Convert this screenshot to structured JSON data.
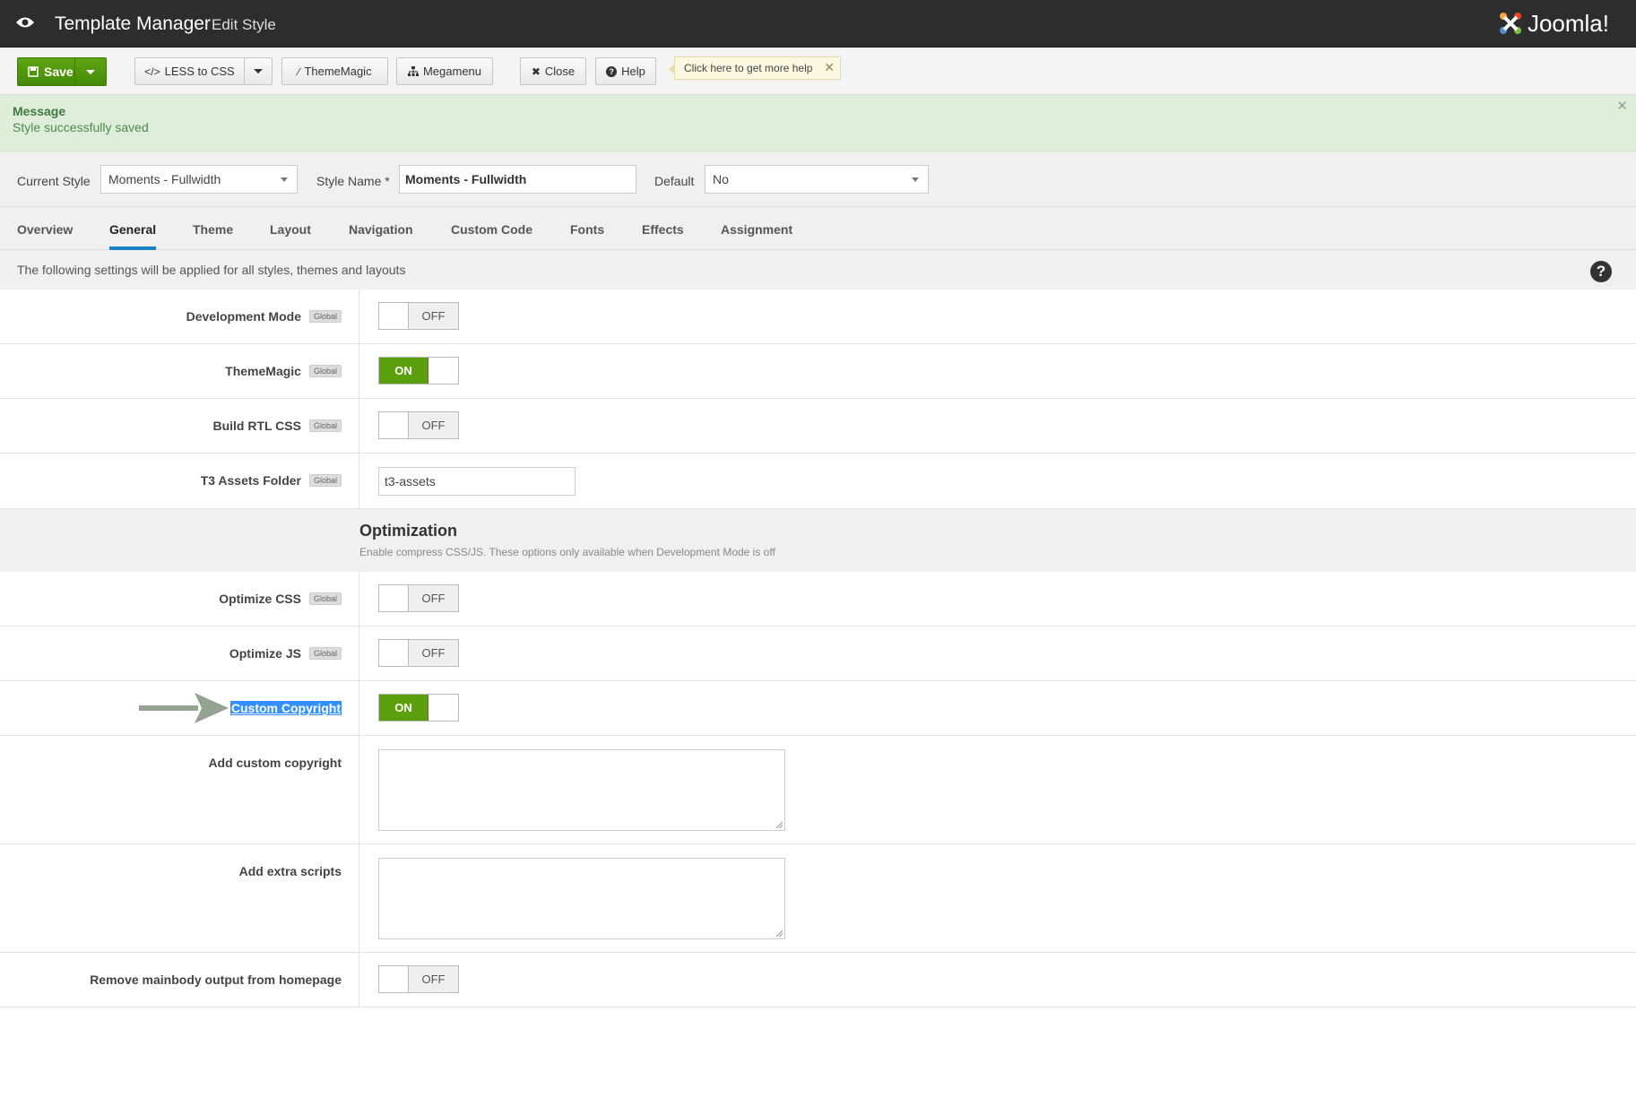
{
  "header": {
    "title": "Template Manager",
    "subtitle": "Edit Style",
    "logo_text": "Joomla!",
    "colors": {
      "bg": "#2d2d2d",
      "accent": "#1a82c5",
      "success": "#5b9f0c"
    }
  },
  "toolbar": {
    "save_label": "Save",
    "less_label": "LESS to CSS",
    "thememagic_label": "ThemeMagic",
    "megamenu_label": "Megamenu",
    "close_label": "Close",
    "help_label": "Help",
    "tooltip_text": "Click here to get more help"
  },
  "message": {
    "title": "Message",
    "body": "Style successfully saved"
  },
  "style_bar": {
    "current_style_label": "Current Style",
    "current_style_value": "Moments - Fullwidth",
    "style_name_label": "Style Name *",
    "style_name_value": "Moments - Fullwidth",
    "default_label": "Default",
    "default_value": "No"
  },
  "tabs": [
    {
      "label": "Overview"
    },
    {
      "label": "General"
    },
    {
      "label": "Theme"
    },
    {
      "label": "Layout"
    },
    {
      "label": "Navigation"
    },
    {
      "label": "Custom Code"
    },
    {
      "label": "Fonts"
    },
    {
      "label": "Effects"
    },
    {
      "label": "Assignment"
    }
  ],
  "active_tab": "General",
  "info_text": "The following settings will be applied for all styles, themes and layouts",
  "badge_text": "Global",
  "settings": {
    "dev_mode": {
      "label": "Development Mode",
      "state": "OFF"
    },
    "thememagic": {
      "label": "ThemeMagic",
      "state": "ON"
    },
    "rtl": {
      "label": "Build RTL CSS",
      "state": "OFF"
    },
    "assets": {
      "label": "T3 Assets Folder",
      "value": "t3-assets"
    },
    "optimize_css": {
      "label": "Optimize CSS",
      "state": "OFF"
    },
    "optimize_js": {
      "label": "Optimize JS",
      "state": "OFF"
    },
    "custom_copyright": {
      "label": "Custom Copyright",
      "state": "ON"
    },
    "add_custom_copyright": {
      "label": "Add custom copyright",
      "value": ""
    },
    "add_extra_scripts": {
      "label": "Add extra scripts",
      "value": ""
    },
    "remove_mainbody": {
      "label": "Remove mainbody output from homepage",
      "state": "OFF"
    }
  },
  "optimization": {
    "heading": "Optimization",
    "description": "Enable compress CSS/JS. These options only available when Development Mode is off"
  }
}
